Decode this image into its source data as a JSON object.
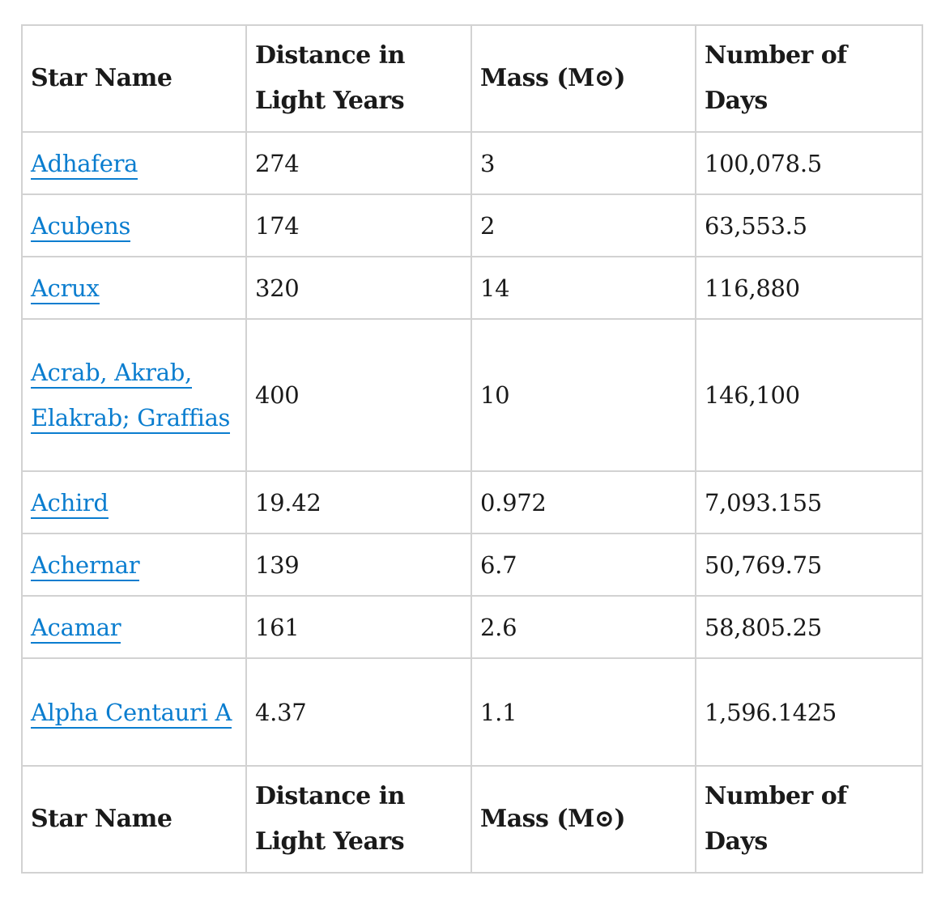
{
  "table": {
    "headers": [
      "Star Name",
      "Distance in Light Years",
      "Mass (M⊙)",
      "Number of Days"
    ],
    "rows": [
      {
        "name": "Adhafera",
        "distance": "274",
        "mass": "3",
        "days": "100,078.5"
      },
      {
        "name": "Acubens",
        "distance": "174",
        "mass": "2",
        "days": "63,553.5"
      },
      {
        "name": "Acrux",
        "distance": "320",
        "mass": "14",
        "days": "116,880"
      },
      {
        "name": "Acrab, Akrab, Elakrab; Graffias",
        "distance": "400",
        "mass": "10",
        "days": "146,100"
      },
      {
        "name": "Achird",
        "distance": "19.42",
        "mass": "0.972",
        "days": "7,093.155"
      },
      {
        "name": "Achernar",
        "distance": "139",
        "mass": "6.7",
        "days": "50,769.75"
      },
      {
        "name": "Acamar",
        "distance": "161",
        "mass": "2.6",
        "days": "58,805.25"
      },
      {
        "name": "Alpha Centauri A",
        "distance": "4.37",
        "mass": "1.1",
        "days": "1,596.1425"
      }
    ],
    "footers": [
      "Star Name",
      "Distance in Light Years",
      "Mass (M⊙)",
      "Number of Days"
    ]
  },
  "colors": {
    "link": "#0a7dcf",
    "border": "#d2d2d2",
    "text": "#1a1a1a"
  }
}
